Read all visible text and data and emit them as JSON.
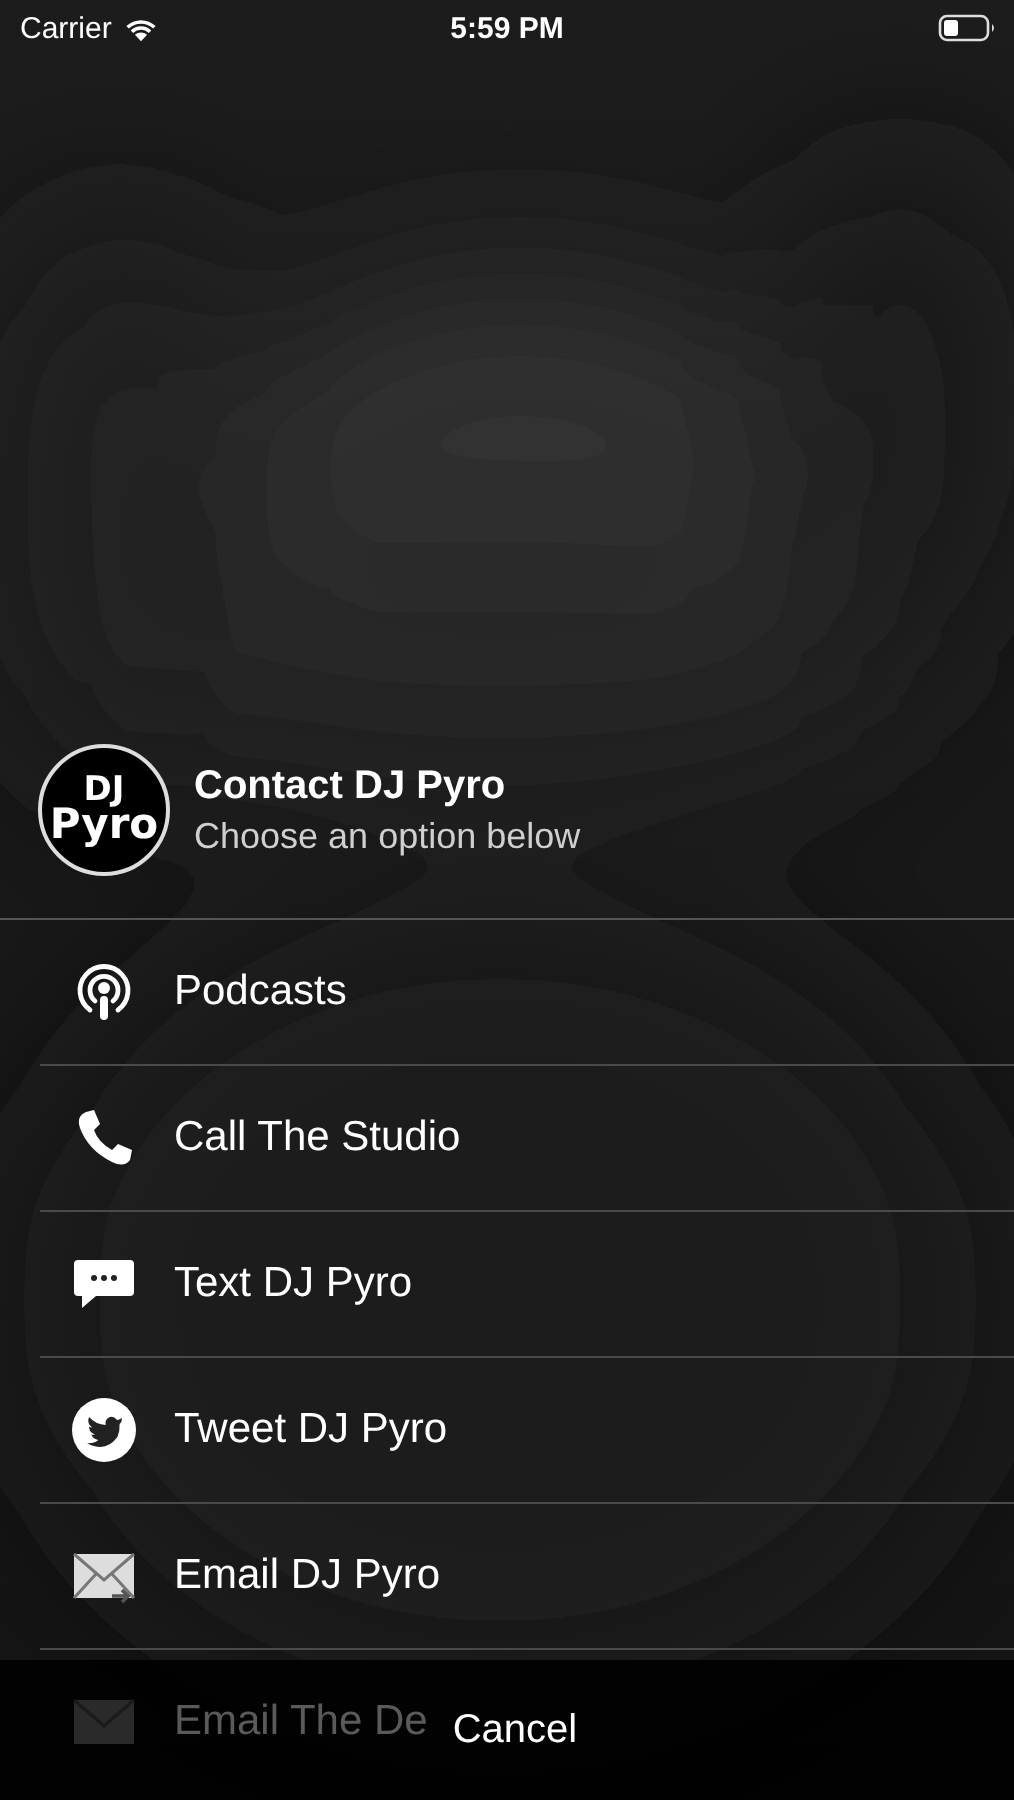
{
  "status_bar": {
    "carrier": "Carrier",
    "time": "5:59 PM"
  },
  "header": {
    "logo": {
      "line_1": "DJ",
      "line_2": "Pyro"
    },
    "title": "Contact DJ Pyro",
    "subtitle": "Choose an option below"
  },
  "options": [
    {
      "kind": "podcast",
      "label": "Podcasts"
    },
    {
      "kind": "phone",
      "label": "Call The Studio"
    },
    {
      "kind": "message",
      "label": "Text DJ Pyro"
    },
    {
      "kind": "bird",
      "label": "Tweet DJ Pyro"
    },
    {
      "kind": "mail-send",
      "label": "Email DJ Pyro"
    },
    {
      "kind": "mail",
      "label": "Email The De"
    }
  ],
  "cancel_button": {
    "label": "Cancel"
  }
}
